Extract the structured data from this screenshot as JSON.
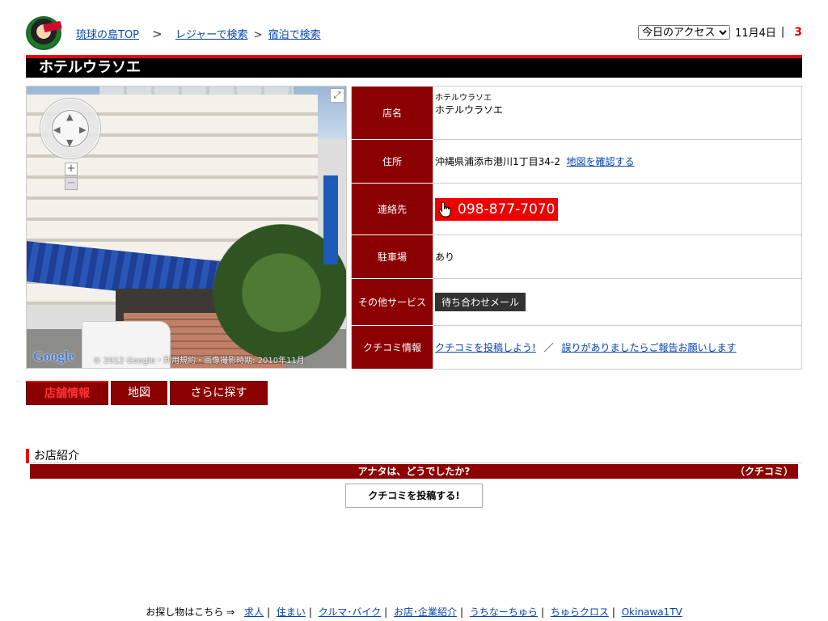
{
  "header": {
    "breadcrumbs": [
      "琉球の島TOP",
      ">",
      "レジャーで検索",
      ">",
      "宿泊で検索"
    ],
    "access_select": "今日のアクセス",
    "date": "11月4日",
    "pipe": "|",
    "access_count": "3"
  },
  "title": "ホテルウラソエ",
  "streetview": {
    "google_logo": "Google",
    "copyright": "© 2012 Google・利用規約・画像撮影時期: 2010年11月"
  },
  "info": {
    "rows": [
      {
        "label": "店名",
        "value_small": "ホテルウラソエ",
        "value": "ホテルウラソエ"
      },
      {
        "label": "住所",
        "value": "沖縄県浦添市港川1丁目34-2",
        "link": "地図を確認する"
      },
      {
        "label": "連絡先",
        "phone": "098-877-7070"
      },
      {
        "label": "駐車場",
        "value": "あり"
      },
      {
        "label": "その他サービス",
        "button": "待ち合わせメール"
      },
      {
        "label": "クチコミ情報",
        "link1": "クチコミを投稿しよう!",
        "sep": "／",
        "link2": "誤りがありましたらご報告お願いします"
      }
    ]
  },
  "tabs": [
    "店舗情報",
    "地図",
    "さらに探す"
  ],
  "intro": {
    "title": "お店紹介",
    "question": "アナタは、どうでしたか?",
    "kuchikomi": "（クチコミ）",
    "post_button": "クチコミを投稿する!"
  },
  "footer": {
    "label": "お探し物はこちら ⇒",
    "links": [
      "求人",
      "住まい",
      "クルマ･バイク",
      "お店･企業紹介",
      "うちなーちゅら",
      "ちゅらクロス",
      "Okinawa1TV"
    ]
  }
}
